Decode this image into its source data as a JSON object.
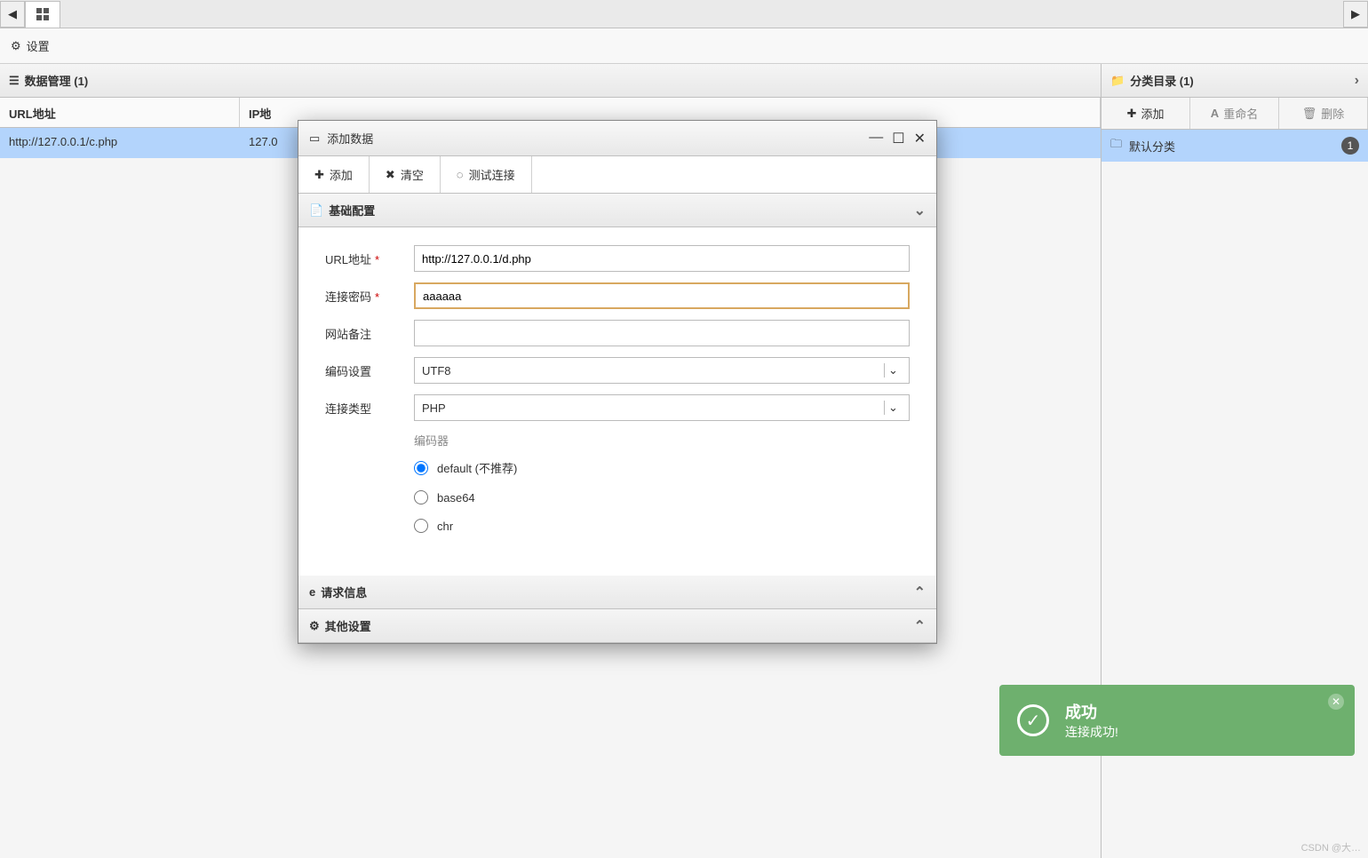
{
  "tabbar": {
    "nav_left": "◀",
    "nav_right": "▶"
  },
  "settings": {
    "label": "设置"
  },
  "data_panel": {
    "title": "数据管理 (1)",
    "columns": {
      "url": "URL地址",
      "ip": "IP地"
    },
    "rows": [
      {
        "url": "http://127.0.0.1/c.php",
        "ip": "127.0"
      }
    ]
  },
  "category_panel": {
    "title": "分类目录 (1)",
    "toolbar": {
      "add": "添加",
      "rename": "重命名",
      "delete": "删除"
    },
    "items": [
      {
        "label": "默认分类",
        "count": "1"
      }
    ]
  },
  "modal": {
    "title": "添加数据",
    "toolbar": {
      "add": "添加",
      "clear": "清空",
      "test": "测试连接"
    },
    "sections": {
      "basic": "基础配置",
      "request": "请求信息",
      "other": "其他设置"
    },
    "form": {
      "url_label": "URL地址",
      "url_value": "http://127.0.0.1/d.php",
      "password_label": "连接密码",
      "password_value": "aaaaaa",
      "note_label": "网站备注",
      "note_value": "",
      "encoding_label": "编码设置",
      "encoding_value": "UTF8",
      "type_label": "连接类型",
      "type_value": "PHP",
      "encoder_label": "编码器",
      "encoders": [
        {
          "label": "default (不推荐)",
          "checked": true
        },
        {
          "label": "base64",
          "checked": false
        },
        {
          "label": "chr",
          "checked": false
        }
      ]
    }
  },
  "toast": {
    "title": "成功",
    "message": "连接成功!"
  },
  "watermark": "CSDN @大…"
}
